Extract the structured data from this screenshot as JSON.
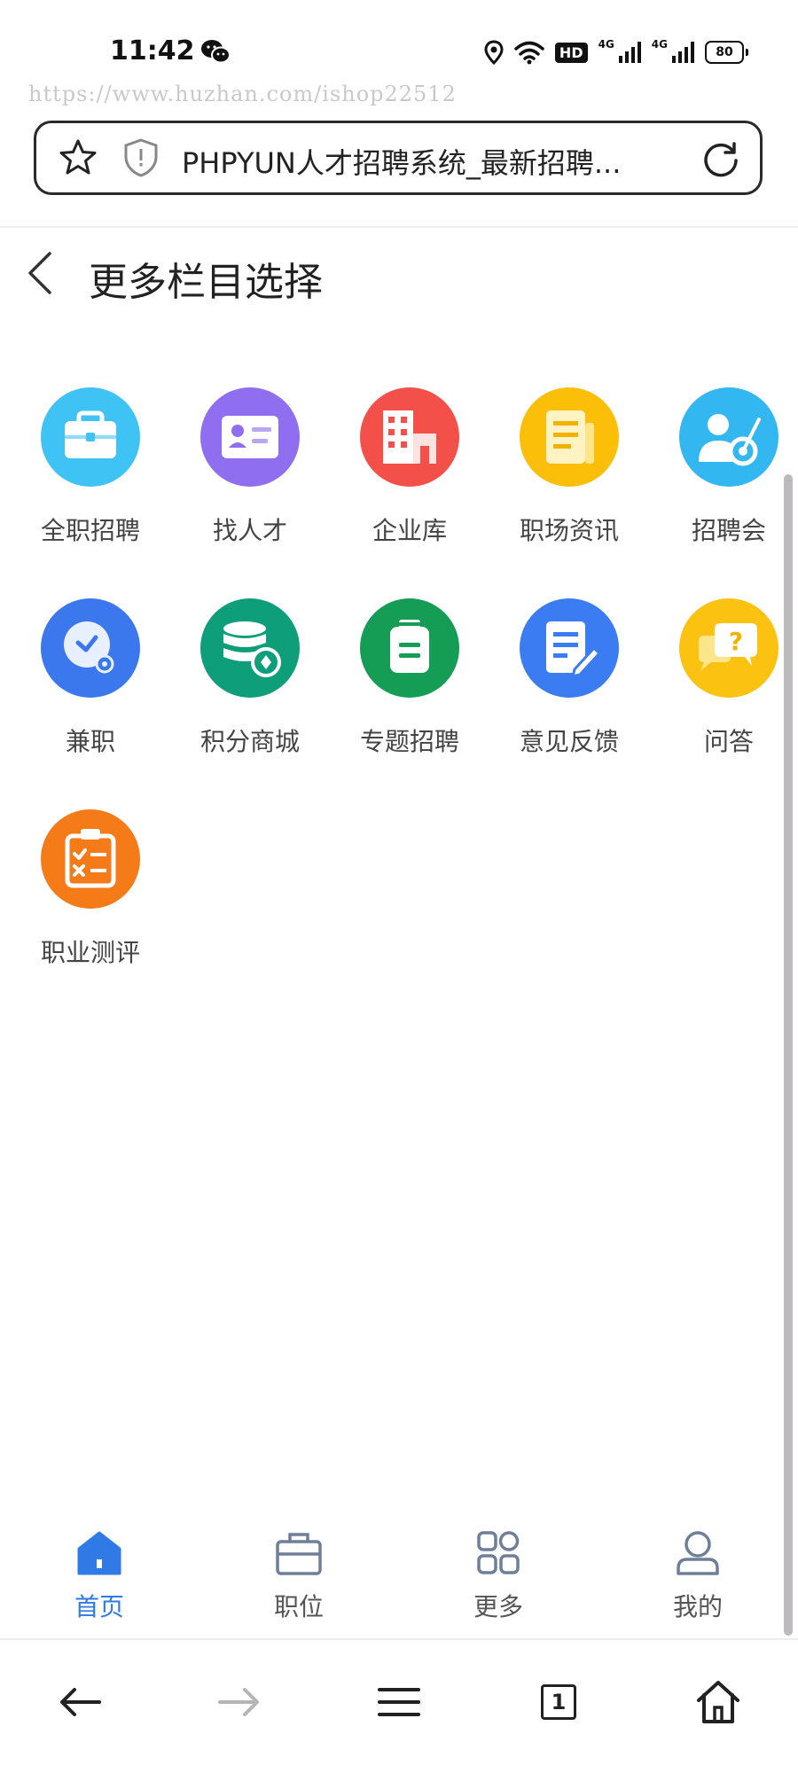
{
  "status": {
    "time": "11:42",
    "net1": "4G",
    "net2": "4G",
    "hd": "HD",
    "battery": "80"
  },
  "watermark": "https://www.huzhan.com/ishop22512",
  "browser": {
    "url_title": "PHPYUN人才招聘系统_最新招聘..."
  },
  "header": {
    "title": "更多栏目选择"
  },
  "grid": [
    {
      "label": "全职招聘",
      "icon": "briefcase-icon",
      "color": "#3fc3f5"
    },
    {
      "label": "找人才",
      "icon": "id-card-icon",
      "color": "#8f6ef0"
    },
    {
      "label": "企业库",
      "icon": "building-icon",
      "color": "#f4504a"
    },
    {
      "label": "职场资讯",
      "icon": "newspaper-icon",
      "color": "#fbbf0a"
    },
    {
      "label": "招聘会",
      "icon": "person-target-icon",
      "color": "#33b7f0"
    },
    {
      "label": "兼职",
      "icon": "clock-icon",
      "color": "#3b78ed"
    },
    {
      "label": "积分商城",
      "icon": "coin-database-icon",
      "color": "#0f9e7a"
    },
    {
      "label": "专题招聘",
      "icon": "clipboard-icon",
      "color": "#159c55"
    },
    {
      "label": "意见反馈",
      "icon": "edit-document-icon",
      "color": "#3b7cf2"
    },
    {
      "label": "问答",
      "icon": "question-chat-icon",
      "color": "#fbc212"
    },
    {
      "label": "职业测评",
      "icon": "checklist-icon",
      "color": "#f57a18"
    }
  ],
  "tabbar": [
    {
      "label": "首页",
      "icon": "home-icon",
      "active": true
    },
    {
      "label": "职位",
      "icon": "briefcase-outline-icon",
      "active": false
    },
    {
      "label": "更多",
      "icon": "grid-icon",
      "active": false
    },
    {
      "label": "我的",
      "icon": "user-icon",
      "active": false
    }
  ],
  "browser_nav": {
    "tabs_count": "1"
  },
  "colors": {
    "accent": "#2f7ae5",
    "tab_inactive": "#6f7f99"
  }
}
